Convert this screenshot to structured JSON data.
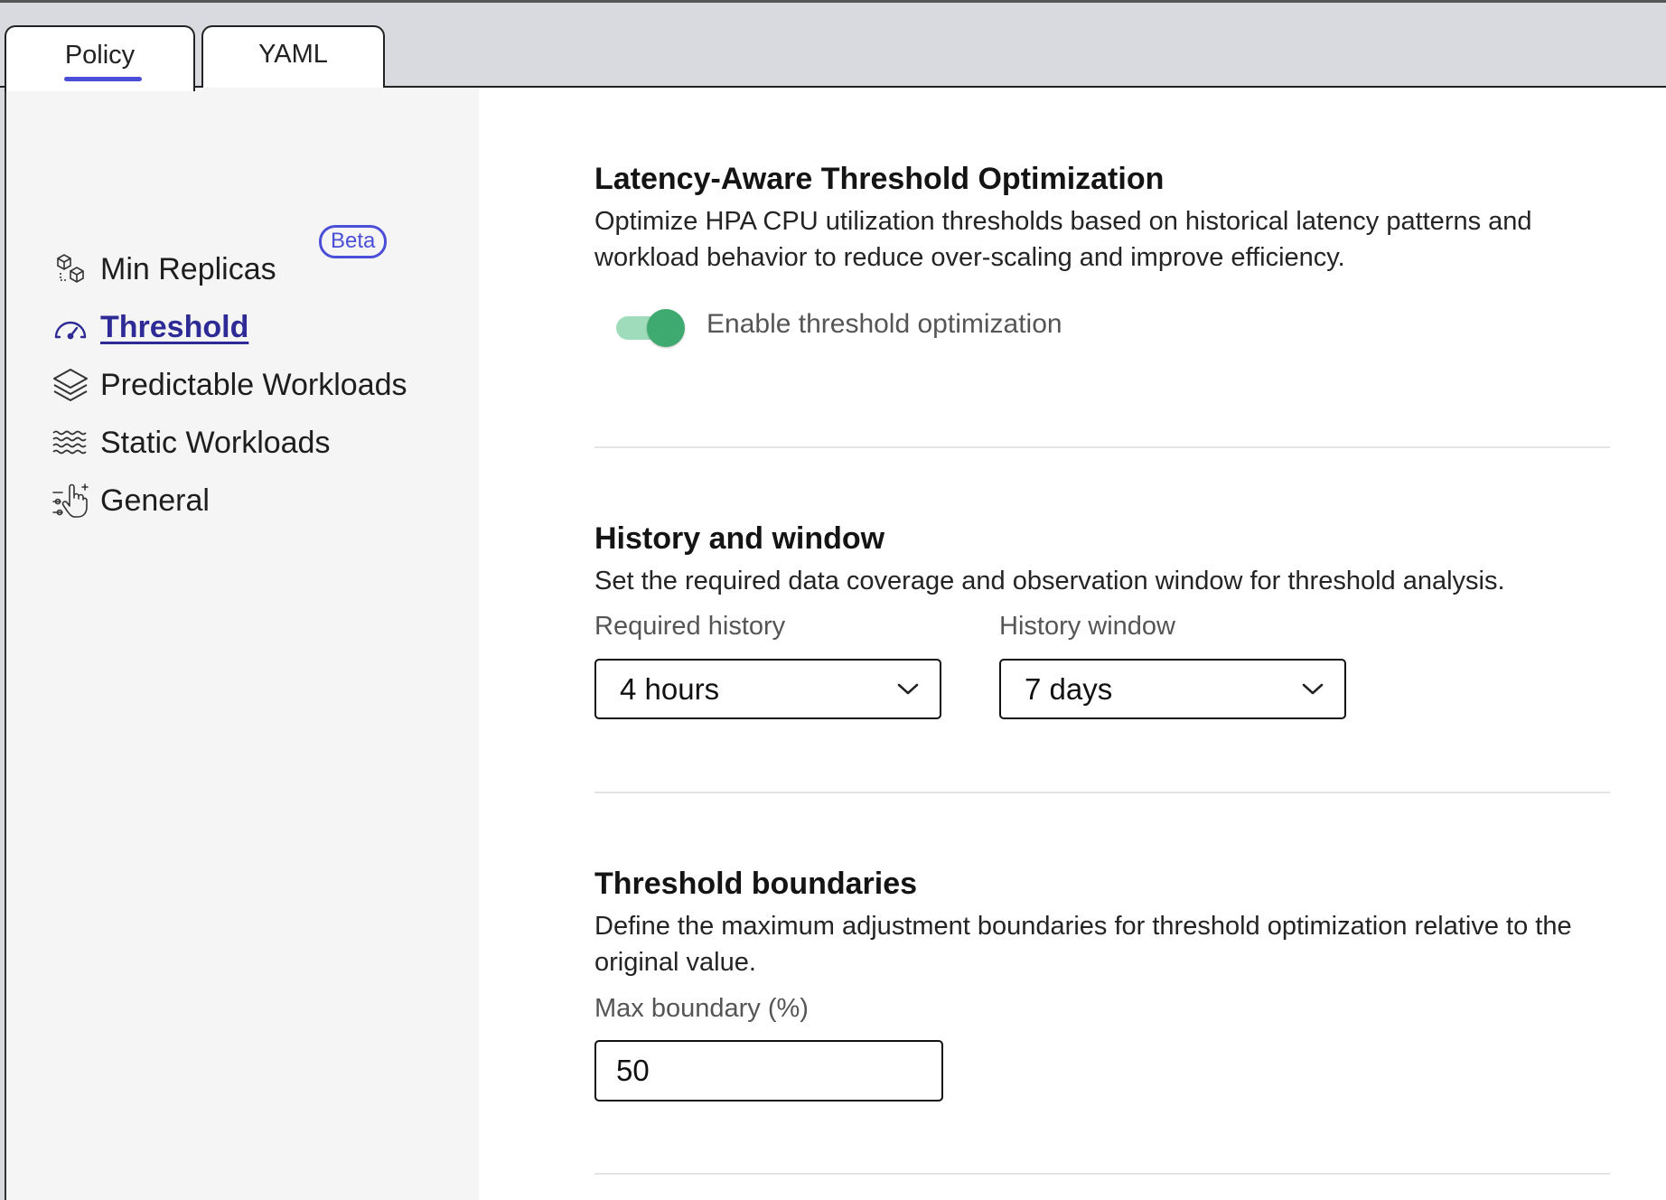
{
  "tabs": [
    {
      "label": "Policy",
      "active": true
    },
    {
      "label": "YAML",
      "active": false
    }
  ],
  "sidebar": {
    "items": [
      {
        "label": "Min Replicas",
        "icon": "cubes-icon"
      },
      {
        "label": "Threshold",
        "icon": "gauge-icon",
        "active": true,
        "badge": "Beta"
      },
      {
        "label": "Predictable Workloads",
        "icon": "layers-icon"
      },
      {
        "label": "Static Workloads",
        "icon": "waves-icon"
      },
      {
        "label": "General",
        "icon": "hand-pointer-sliders-icon"
      }
    ]
  },
  "sections": {
    "optimization": {
      "title": "Latency-Aware Threshold Optimization",
      "description": "Optimize HPA CPU utilization thresholds based on historical latency patterns and workload behavior to reduce over-scaling and improve efficiency.",
      "toggle_label": "Enable threshold optimization",
      "toggle_on": true
    },
    "history": {
      "title": "History and window",
      "description": "Set the required data coverage and observation window for threshold analysis.",
      "required_history_label": "Required history",
      "required_history_value": "4 hours",
      "history_window_label": "History window",
      "history_window_value": "7 days"
    },
    "boundaries": {
      "title": "Threshold boundaries",
      "description": "Define the maximum adjustment boundaries for threshold optimization relative to the original value.",
      "max_boundary_label": "Max boundary (%)",
      "max_boundary_value": "50"
    }
  },
  "colors": {
    "accent": "#4b4fd8",
    "active_nav": "#2f2b96",
    "toggle_on": "#3faa6f",
    "toggle_track": "#9edcbb",
    "tabbar_bg": "#d9d9e0",
    "sidebar_bg": "#f5f5f5"
  }
}
